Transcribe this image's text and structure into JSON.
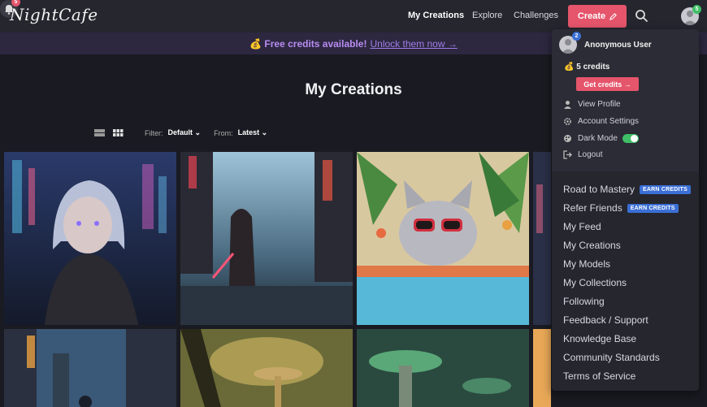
{
  "brand": {
    "logo_text": "NightCafe"
  },
  "nav": {
    "my_creations": "My Creations",
    "explore": "Explore",
    "challenges": "Challenges",
    "create": "Create",
    "notif_count": "5",
    "avatar_count": "5"
  },
  "banner": {
    "free": "💰 Free credits available!",
    "unlock": "Unlock them now →"
  },
  "page": {
    "title": "My Creations",
    "filter_label": "Filter:",
    "filter_value": "Default",
    "from_label": "From:",
    "from_value": "Latest"
  },
  "dropdown": {
    "avatar_count": "2",
    "user_name": "Anonymous User",
    "credits": "💰 5 credits",
    "get_credits": "Get credits →",
    "view_profile": "View Profile",
    "account_settings": "Account Settings",
    "dark_mode": "Dark Mode",
    "dark_mode_on": true,
    "logout": "Logout",
    "links": [
      {
        "label": "Road to Mastery",
        "badge": "EARN CREDITS"
      },
      {
        "label": "Refer Friends",
        "badge": "EARN CREDITS"
      },
      {
        "label": "My Feed"
      },
      {
        "label": "My Creations"
      },
      {
        "label": "My Models"
      },
      {
        "label": "My Collections"
      },
      {
        "label": "Following"
      },
      {
        "label": "Feedback / Support"
      },
      {
        "label": "Knowledge Base"
      },
      {
        "label": "Community Standards"
      },
      {
        "label": "Terms of Service"
      }
    ]
  },
  "gallery": {
    "items": [
      "cyberpunk-girl-image",
      "samurai-city-image",
      "cat-sunglasses-image",
      "partial-image-4",
      "city-drone-image",
      "mushroom-forest-image",
      "green-mushroom-image",
      "sunset-image"
    ]
  },
  "colors": {
    "accent": "#e5556b",
    "banner_text": "#b98cf2",
    "earn_badge": "#3b6fd6",
    "toggle_on": "#3fbf66"
  }
}
